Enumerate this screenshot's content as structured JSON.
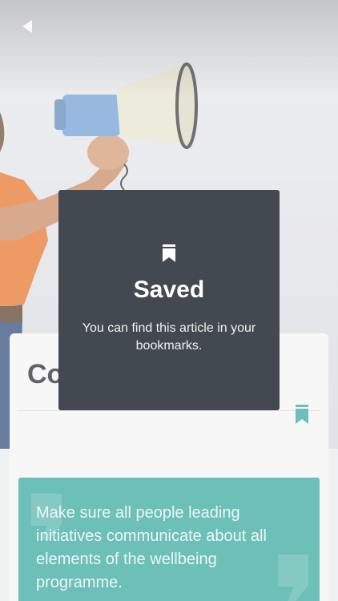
{
  "header": {
    "back_icon": "back-arrow-icon"
  },
  "article": {
    "title": "Co",
    "bookmark_icon": "bookmark-icon",
    "quote": "Make sure all people leading initiatives communicate about all elements of the wellbeing programme."
  },
  "toast": {
    "icon": "bookmark-icon",
    "title": "Saved",
    "message": "You can find this article in your bookmarks."
  },
  "colors": {
    "accent": "#35a89c",
    "toast_bg": "#434950",
    "megaphone_blue": "#6f9fd4",
    "shirt_orange": "#e8742a"
  }
}
